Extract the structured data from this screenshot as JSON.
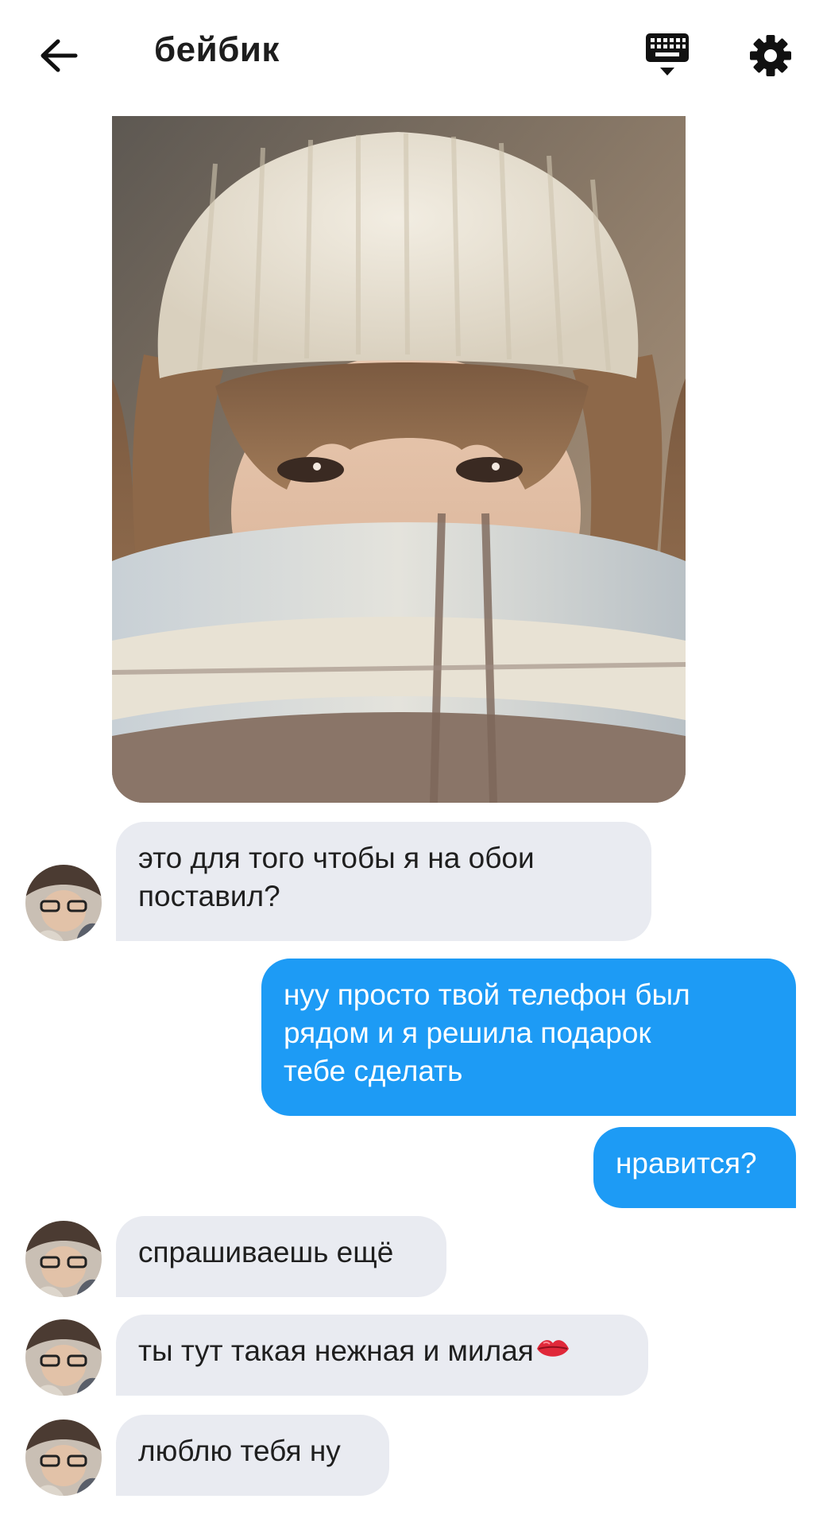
{
  "header": {
    "title": "бейбик",
    "back_icon": "arrow-left-icon",
    "keyboard_icon": "keyboard-icon",
    "settings_icon": "gear-icon"
  },
  "photo": {
    "description_icon": "photo-image"
  },
  "messages": [
    {
      "direction": "in",
      "text": "это для того чтобы я на обои\nпоставил?"
    },
    {
      "direction": "out",
      "text": "нуу просто твой телефон был\nрядом и я решила подарок\nтебе сделать"
    },
    {
      "direction": "out",
      "text": "нравится?"
    },
    {
      "direction": "in",
      "text": "спрашиваешь ещё"
    },
    {
      "direction": "in",
      "text": "ты тут такая нежная и милая",
      "emoji": "kiss-mark-icon"
    },
    {
      "direction": "in",
      "text": "люблю тебя ну"
    }
  ],
  "colors": {
    "incoming_bubble": "#e9ebf1",
    "outgoing_bubble": "#1d9bf5",
    "text_dark": "#1f1f1f",
    "text_light": "#ffffff"
  }
}
